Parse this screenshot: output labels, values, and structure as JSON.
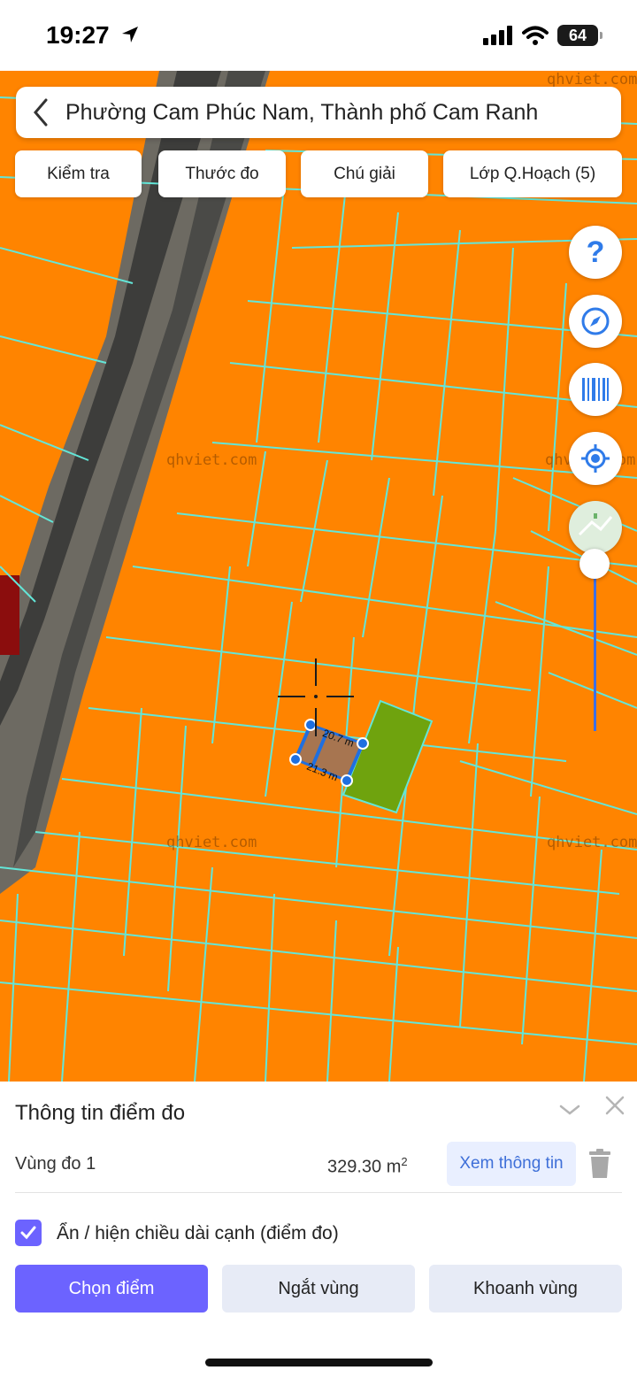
{
  "status_bar": {
    "time": "19:27",
    "battery": "64"
  },
  "header": {
    "back_icon": "chevron-left-icon",
    "location_title": "Phường Cam Phúc Nam, Thành phố Cam Ranh"
  },
  "toolbar": {
    "check_label": "Kiểm tra",
    "ruler_label": "Thước đo",
    "legend_label": "Chú giải",
    "layers_label": "Lớp Q.Hoạch (5)"
  },
  "map": {
    "watermark": "qhviet.com",
    "edge_label_top": "20.7 m",
    "edge_label_bottom": "21.3 m",
    "colors": {
      "land": "#ff8400",
      "parcel_line": "#63e6d8",
      "highlight_parcel": "#6fa30e",
      "measure_area": "#a77550",
      "measure_point": "#1f6fe0"
    },
    "controls": [
      "help-icon",
      "compass-icon",
      "barcode-icon",
      "locate-icon",
      "basemap-icon"
    ]
  },
  "sheet": {
    "title": "Thông tin điểm đo",
    "row": {
      "label": "Vùng đo 1",
      "area_value": "329.30 m",
      "area_unit_exp": "2",
      "info_button": "Xem thông tin"
    },
    "toggle_label": "Ẩn / hiện chiều dài cạnh (điểm đo)",
    "toggle_checked": true,
    "actions": {
      "pick_point": "Chọn điểm",
      "break_area": "Ngắt vùng",
      "area_select": "Khoanh vùng"
    },
    "accent_color": "#6c63ff"
  }
}
